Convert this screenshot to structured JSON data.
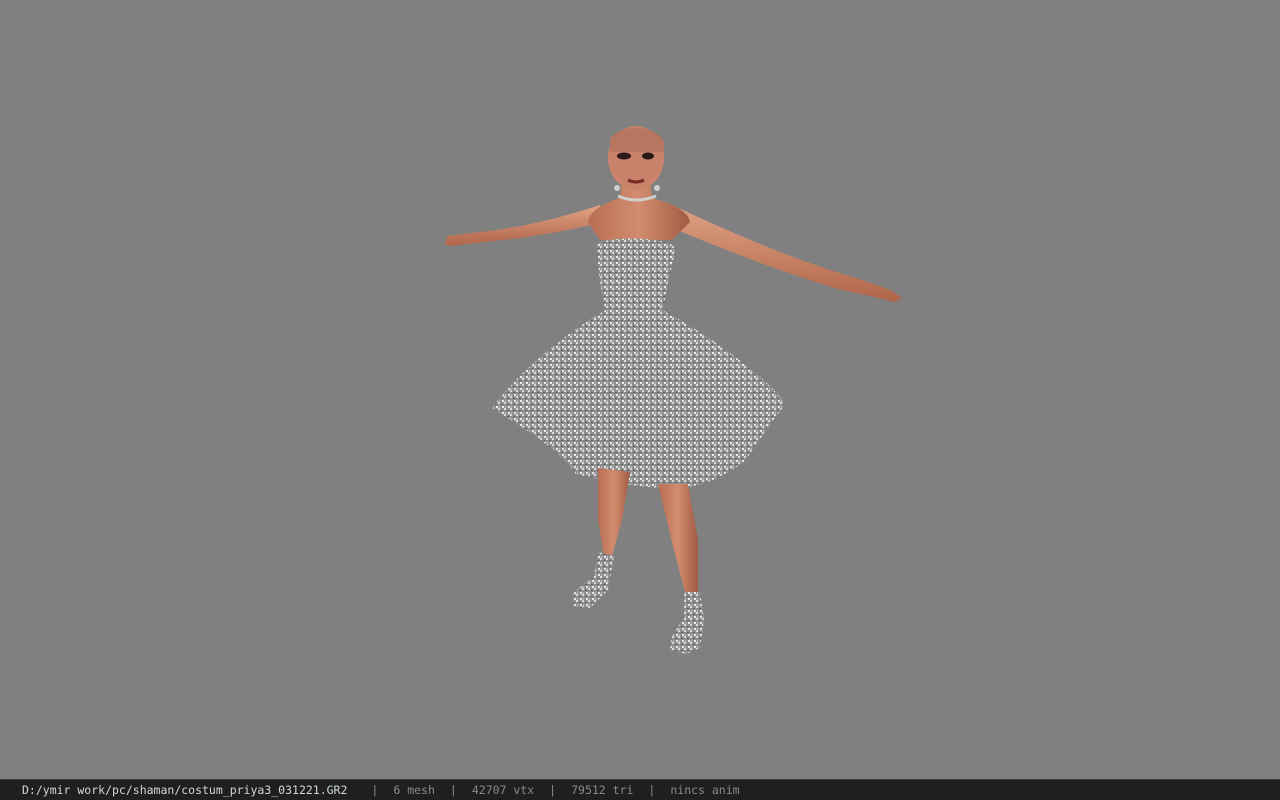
{
  "viewer": {
    "background_color": "#808080",
    "model_label": "3D character model in T-pose wearing a silver sparkly strapless dress"
  },
  "status": {
    "file_path": "D:/ymir work/pc/shaman/costum_priya3_031221.GR2",
    "mesh_count": "6 mesh",
    "vertex_count": "42707 vtx",
    "triangle_count": "79512 tri",
    "anim_status": "nincs anim",
    "separator": "|"
  }
}
